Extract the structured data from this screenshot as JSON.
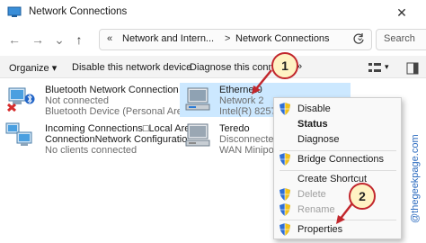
{
  "window": {
    "title": "Network Connections",
    "close_glyph": "✕"
  },
  "nav": {
    "breadcrumb_prefix": "«",
    "crumbs": [
      "Network and Intern...",
      "Network Connections"
    ],
    "crumb_separator": ">",
    "search_placeholder": "Search"
  },
  "toolbar": {
    "organize": "Organize ▾",
    "disable": "Disable this network device",
    "diagnose": "Diagnose this connectio",
    "more": "»"
  },
  "connections": [
    {
      "name": "Bluetooth Network Connection",
      "status": "Not connected",
      "device": "Bluetooth Device (Personal Area ..."
    },
    {
      "name": "Ethernet0",
      "status": "Network 2",
      "device": "Intel(R) 82574L"
    },
    {
      "name": "Incoming Connections□Local Area",
      "status": "ConnectionNetwork Configuratio...",
      "device": "No clients connected"
    },
    {
      "name": "Teredo",
      "status": "Disconnected",
      "device": "WAN Miniport"
    }
  ],
  "context_menu": {
    "items": [
      {
        "label": "Disable",
        "shield": true,
        "bold": false,
        "disabled": false
      },
      {
        "label": "Status",
        "shield": false,
        "bold": true,
        "disabled": false
      },
      {
        "label": "Diagnose",
        "shield": false,
        "bold": false,
        "disabled": false
      },
      {
        "label": "Bridge Connections",
        "shield": true,
        "bold": false,
        "disabled": false
      },
      {
        "label": "Create Shortcut",
        "shield": false,
        "bold": false,
        "disabled": false
      },
      {
        "label": "Delete",
        "shield": true,
        "bold": false,
        "disabled": true
      },
      {
        "label": "Rename",
        "shield": true,
        "bold": false,
        "disabled": true
      },
      {
        "label": "Properties",
        "shield": true,
        "bold": false,
        "disabled": false
      }
    ]
  },
  "callouts": [
    "1",
    "2"
  ],
  "watermark": "@thegeekpage.com",
  "colors": {
    "selection": "#cce8ff",
    "callout_border": "#c2272d",
    "callout_fill": "#fff3c4",
    "watermark": "#2c6bbf"
  }
}
